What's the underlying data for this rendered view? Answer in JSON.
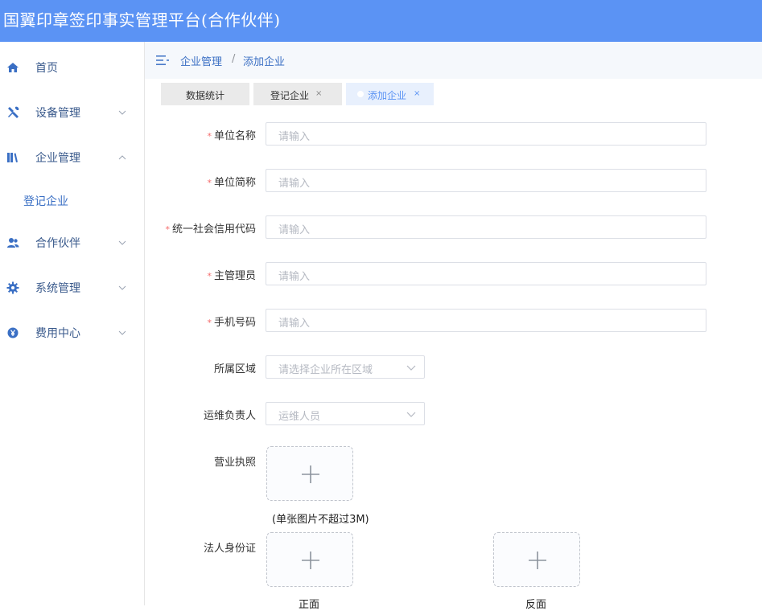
{
  "header": {
    "title": "国翼印章签印事实管理平台(合作伙伴)"
  },
  "sidebar": {
    "items": [
      {
        "label": "首页"
      },
      {
        "label": "设备管理"
      },
      {
        "label": "企业管理"
      },
      {
        "label": "合作伙伴"
      },
      {
        "label": "系统管理"
      },
      {
        "label": "费用中心"
      }
    ],
    "submenu": {
      "label": "登记企业"
    }
  },
  "breadcrumb": {
    "parent": "企业管理",
    "separator": "/",
    "current": "添加企业"
  },
  "tabs": [
    {
      "label": "数据统计"
    },
    {
      "label": "登记企业",
      "close": "×"
    },
    {
      "label": "添加企业",
      "close": "×"
    }
  ],
  "form": {
    "required_mark": "*",
    "unit_name": {
      "label": "单位名称",
      "placeholder": "请输入"
    },
    "unit_short": {
      "label": "单位简称",
      "placeholder": "请输入"
    },
    "credit_code": {
      "label": "统一社会信用代码",
      "placeholder": "请输入"
    },
    "admin": {
      "label": "主管理员",
      "placeholder": "请输入"
    },
    "phone": {
      "label": "手机号码",
      "placeholder": "请输入"
    },
    "region": {
      "label": "所属区域",
      "placeholder": "请选择企业所在区域"
    },
    "ops_owner": {
      "label": "运维负责人",
      "placeholder": "运维人员"
    },
    "license": {
      "label": "营业执照",
      "note": "(单张图片不超过3M)"
    },
    "id_card": {
      "label": "法人身份证",
      "front": "正面",
      "back": "反面"
    }
  },
  "colors": {
    "header": "#5b93f4",
    "accent": "#3a6fc4",
    "required": "#f56c6c"
  }
}
